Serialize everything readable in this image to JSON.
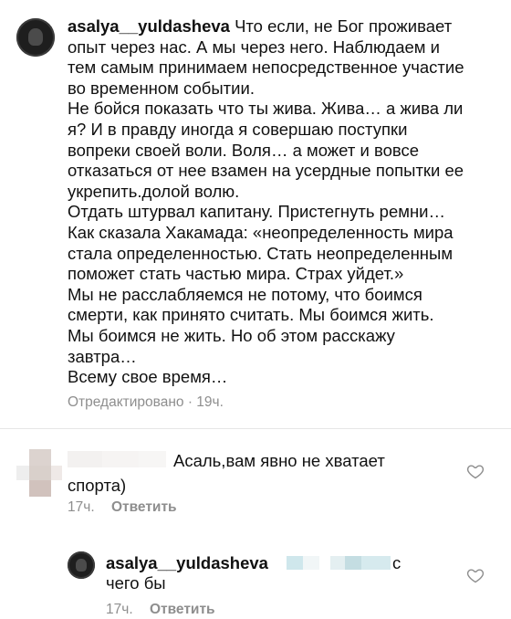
{
  "post": {
    "username": "asalya__yuldasheva",
    "lines": [
      "Что если, не Бог проживает",
      "опыт через нас. А мы через него. Наблюдаем и",
      "тем самым принимаем непосредственное участие",
      "во временном событии.",
      "Не бойся показать что ты жива. Жива… а жива ли",
      "я? И в правду иногда я совершаю поступки",
      "вопреки своей воли. Воля… а может и вовсе",
      "отказаться от нее взамен на усердные попытки ее",
      "укрепить.долой волю.",
      "Отдать штурвал капитану. Пристегнуть ремни…",
      "Как сказала Хакамада: «неопределенность мира",
      "стала определенностью. Стать неопределенным",
      "поможет стать частью мира. Страх уйдет.»",
      "Мы не расслабляемся не потому, что боимся",
      "смерти, как принято считать. Мы боимся жить.",
      "Мы боимся не жить. Но об этом расскажу",
      "завтра…",
      "Всему свое время…"
    ],
    "meta": "Отредактировано · 19ч."
  },
  "comment1": {
    "line1": "Асаль,вам явно не хватает",
    "line2": "спорта)",
    "time": "17ч.",
    "reply_label": "Ответить"
  },
  "comment2": {
    "username": "asalya__yuldasheva",
    "mention_tail": "с",
    "line2": "чего бы",
    "time": "17ч.",
    "reply_label": "Ответить"
  },
  "icons": {
    "like": "heart-outline-icon",
    "avatar": "profile-avatar"
  },
  "colors": {
    "text": "#111111",
    "secondary": "#8e8e8e",
    "divider": "#dbdbdb"
  }
}
